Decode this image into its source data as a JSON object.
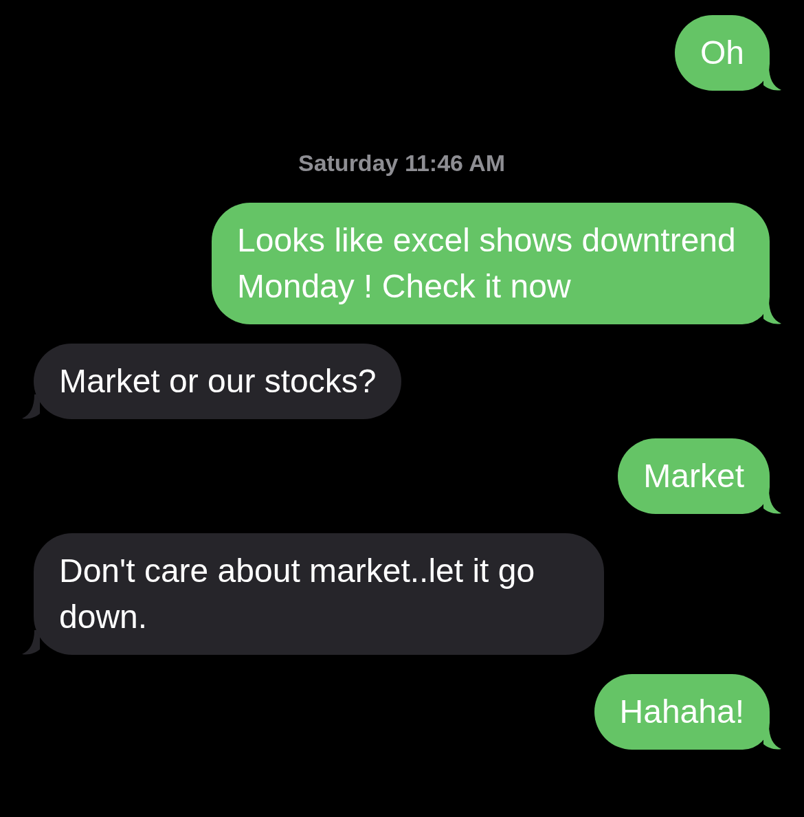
{
  "messages": [
    {
      "kind": "sent",
      "text": "Oh"
    },
    {
      "kind": "timestamp",
      "text": "Saturday 11:46 AM"
    },
    {
      "kind": "sent",
      "text": "Looks like excel shows downtrend Monday ! Check it now"
    },
    {
      "kind": "received",
      "text": "Market or our stocks?"
    },
    {
      "kind": "sent",
      "text": "Market"
    },
    {
      "kind": "received",
      "text": "Don't care about market..let it go down."
    },
    {
      "kind": "sent",
      "text": "Hahaha!"
    }
  ]
}
